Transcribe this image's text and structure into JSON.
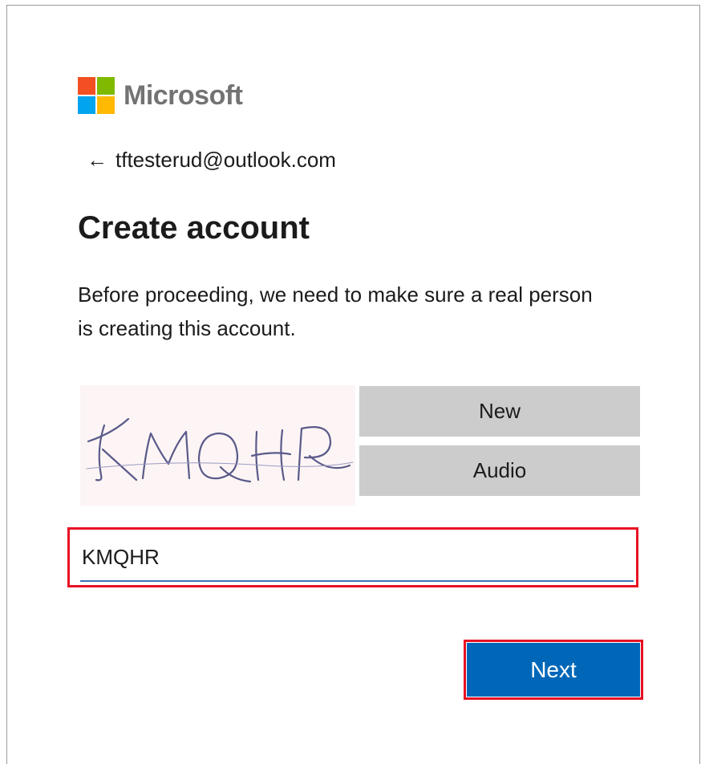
{
  "brand": {
    "name": "Microsoft",
    "logo_colors": [
      "#f25022",
      "#7fba00",
      "#00a4ef",
      "#ffb900"
    ]
  },
  "identity": {
    "back_icon": "back-arrow-icon",
    "email": "tftesterud@outlook.com"
  },
  "page": {
    "title": "Create account",
    "description": "Before proceeding, we need to make sure a real person is creating this account."
  },
  "captcha": {
    "image_text": "KMQHR",
    "new_label": "New",
    "audio_label": "Audio"
  },
  "input": {
    "value": "KMQHR",
    "highlight_color": "#e81123"
  },
  "actions": {
    "next_label": "Next",
    "accent": "#0067b8"
  }
}
